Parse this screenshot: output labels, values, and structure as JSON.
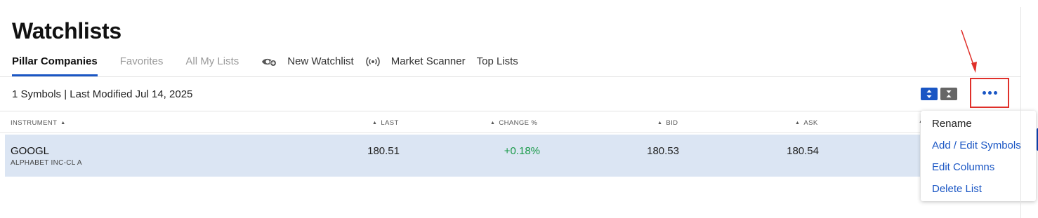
{
  "page_title": "Watchlists",
  "tabs": [
    {
      "label": "Pillar Companies",
      "active": true
    },
    {
      "label": "Favorites",
      "active": false
    },
    {
      "label": "All My Lists",
      "active": false
    }
  ],
  "actions": [
    {
      "label": "New Watchlist",
      "icon": "eye-plus-icon"
    },
    {
      "label": "Market Scanner",
      "icon": "scanner-signal-icon"
    },
    {
      "label": "Top Lists",
      "icon": ""
    }
  ],
  "info": {
    "summary": "1 Symbols | Last Modified Jul 14, 2025"
  },
  "columns": [
    {
      "label": "INSTRUMENT",
      "sort": "asc"
    },
    {
      "label": "LAST",
      "sort": "asc"
    },
    {
      "label": "CHANGE %",
      "sort": "asc"
    },
    {
      "label": "BID",
      "sort": "asc"
    },
    {
      "label": "ASK",
      "sort": "asc"
    }
  ],
  "rows": [
    {
      "symbol": "GOOGL",
      "name": "ALPHABET INC-CL A",
      "last": "180.51",
      "change_pct": "+0.18%",
      "bid": "180.53",
      "ask": "180.54"
    }
  ],
  "menu": {
    "items": [
      "Rename",
      "Add / Edit Symbols",
      "Edit Columns",
      "Delete List"
    ]
  },
  "colors": {
    "accent": "#1a56c4",
    "positive": "#1a9a4a",
    "row_highlight": "#dbe5f3",
    "annotation_red": "#e0302a"
  }
}
